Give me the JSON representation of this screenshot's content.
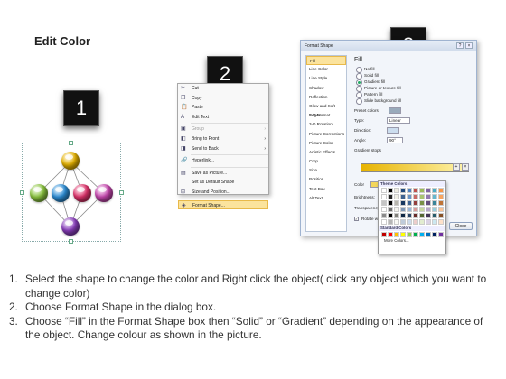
{
  "title": "Edit Color",
  "steps": [
    "1",
    "2",
    "3"
  ],
  "menu": {
    "items": [
      {
        "label": "Cut",
        "icon": "cut-icon",
        "glyph": "✂"
      },
      {
        "label": "Copy",
        "icon": "copy-icon",
        "glyph": "❐"
      },
      {
        "label": "Paste",
        "icon": "paste-icon",
        "glyph": "📋"
      },
      {
        "label": "Edit Text",
        "icon": "edit-text-icon",
        "glyph": "A"
      },
      {
        "label": "Group",
        "icon": "group-icon",
        "glyph": "▣",
        "disabled": true,
        "submenu": true
      },
      {
        "label": "Bring to Front",
        "icon": "bring-front-icon",
        "glyph": "◧",
        "submenu": true
      },
      {
        "label": "Send to Back",
        "icon": "send-back-icon",
        "glyph": "◨",
        "submenu": true
      },
      {
        "label": "Hyperlink...",
        "icon": "hyperlink-icon",
        "glyph": "🔗"
      },
      {
        "label": "Save as Picture...",
        "icon": "save-picture-icon",
        "glyph": "▤"
      },
      {
        "label": "Set as Default Shape",
        "icon": "default-shape-icon",
        "glyph": ""
      },
      {
        "label": "Size and Position...",
        "icon": "size-position-icon",
        "glyph": "⊞"
      },
      {
        "label": "Format Shape...",
        "icon": "format-shape-icon",
        "glyph": "◈",
        "highlight": true
      }
    ]
  },
  "dialog": {
    "title": "Format Shape",
    "categories": [
      "Fill",
      "Line Color",
      "Line Style",
      "Shadow",
      "Reflection",
      "Glow and Soft Edges",
      "3-D Format",
      "3-D Rotation",
      "Picture Corrections",
      "Picture Color",
      "Artistic Effects",
      "Crop",
      "Size",
      "Position",
      "Text Box",
      "Alt Text"
    ],
    "heading": "Fill",
    "options": [
      "No fill",
      "Solid fill",
      "Gradient fill",
      "Picture or texture fill",
      "Pattern fill",
      "Slide background fill"
    ],
    "selected_option": "Gradient fill",
    "preset_colors": "Preset colors:",
    "type_label": "Type:",
    "type_value": "Linear",
    "direction_label": "Direction:",
    "angle_label": "Angle:",
    "angle_value": "90°",
    "gradient_stops": "Gradient stops",
    "color_label": "Color",
    "position_label": "Position:",
    "position_value": "0%",
    "brightness_label": "Brightness:",
    "transparency_label": "Transparency:",
    "rotate_label": "Rotate with shape",
    "close": "Close"
  },
  "palette": {
    "theme_label": "Theme Colors",
    "standard_label": "Standard Colors",
    "more": "More Colors...",
    "theme_colors": [
      "#ffffff",
      "#000000",
      "#eeece1",
      "#1f497d",
      "#4f81bd",
      "#c0504d",
      "#9bbb59",
      "#8064a2",
      "#4bacc6",
      "#f79646"
    ],
    "standard_colors": [
      "#c00000",
      "#ff0000",
      "#ffc000",
      "#ffff00",
      "#92d050",
      "#00b050",
      "#00b0f0",
      "#0070c0",
      "#002060",
      "#7030a0"
    ]
  },
  "diagram": {
    "ball_colors": [
      "#e8b400",
      "#8cc63f",
      "#2d8fd8",
      "#e0336b",
      "#c847b0",
      "#8b3fbf"
    ]
  },
  "instructions": [
    {
      "num": "1.",
      "text": "Select the shape to change the color and Right click the object( click any object which you want to change color)"
    },
    {
      "num": "2.",
      "text": "Choose Format Shape in the dialog box."
    },
    {
      "num": "3.",
      "text": "Choose “Fill” in the Format Shape box then “Solid” or “Gradient” depending on the appearance of the object. Change colour as shown in the picture."
    }
  ]
}
